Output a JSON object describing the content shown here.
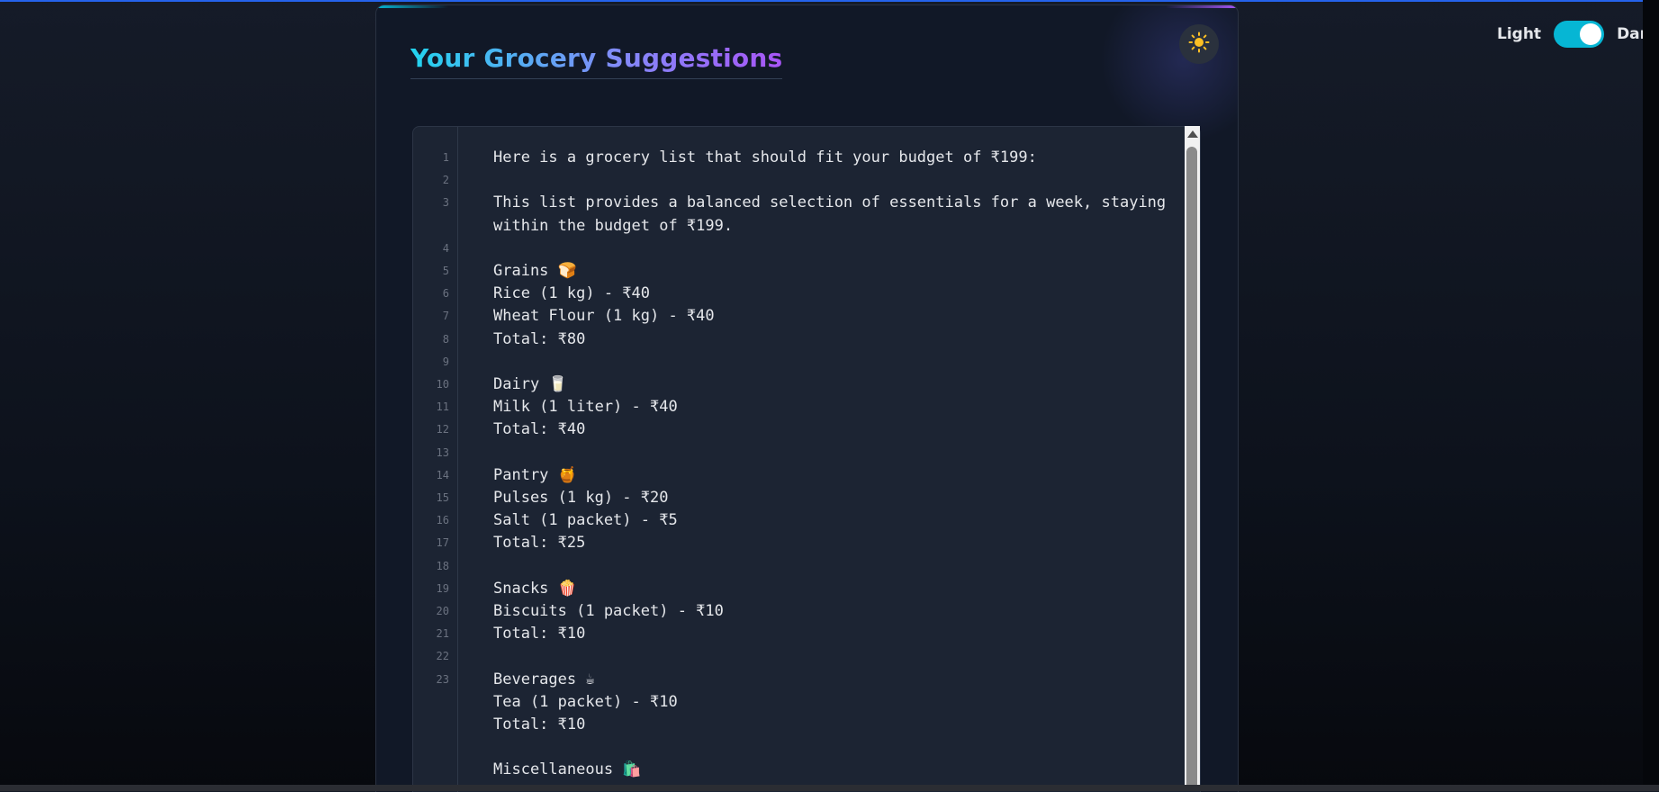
{
  "header": {
    "title": "Your Grocery Suggestions"
  },
  "theme_toggle": {
    "light_label": "Light",
    "dark_label": "Dark",
    "state": "dark"
  },
  "icons": {
    "theme_button": "sun-icon",
    "grains": "bread-icon",
    "dairy": "milk-glass-icon",
    "pantry": "jar-icon",
    "snacks": "popcorn-icon",
    "beverages": "tea-cup-icon",
    "misc": "shopping-bags-icon"
  },
  "colors": {
    "accent": "#06b6d4",
    "title_gradient": [
      "#22d3ee",
      "#818cf8",
      "#a855f7"
    ]
  },
  "editor": {
    "lines": [
      {
        "number": "1",
        "text": "Here is a grocery list that should fit your budget of ₹199:"
      },
      {
        "number": "2",
        "text": ""
      },
      {
        "number": "3",
        "text": "This list provides a balanced selection of essentials for a week, staying"
      },
      {
        "number": "",
        "text": "within the budget of ₹199."
      },
      {
        "number": "4",
        "text": ""
      },
      {
        "number": "5",
        "text": "Grains 🍞"
      },
      {
        "number": "6",
        "text": "Rice (1 kg) - ₹40"
      },
      {
        "number": "7",
        "text": "Wheat Flour (1 kg) - ₹40"
      },
      {
        "number": "8",
        "text": "Total: ₹80"
      },
      {
        "number": "9",
        "text": ""
      },
      {
        "number": "10",
        "text": "Dairy 🥛"
      },
      {
        "number": "11",
        "text": "Milk (1 liter) - ₹40"
      },
      {
        "number": "12",
        "text": "Total: ₹40"
      },
      {
        "number": "13",
        "text": ""
      },
      {
        "number": "14",
        "text": "Pantry 🍯"
      },
      {
        "number": "15",
        "text": "Pulses (1 kg) - ₹20"
      },
      {
        "number": "16",
        "text": "Salt (1 packet) - ₹5"
      },
      {
        "number": "17",
        "text": "Total: ₹25"
      },
      {
        "number": "18",
        "text": ""
      },
      {
        "number": "19",
        "text": "Snacks 🍿"
      },
      {
        "number": "20",
        "text": "Biscuits (1 packet) - ₹10"
      },
      {
        "number": "21",
        "text": "Total: ₹10"
      },
      {
        "number": "22",
        "text": ""
      },
      {
        "number": "23",
        "text": "Beverages ☕"
      },
      {
        "number": "",
        "text": "Tea (1 packet) - ₹10"
      },
      {
        "number": "",
        "text": "Total: ₹10"
      },
      {
        "number": "",
        "text": ""
      },
      {
        "number": "",
        "text": "Miscellaneous 🛍️"
      }
    ]
  }
}
